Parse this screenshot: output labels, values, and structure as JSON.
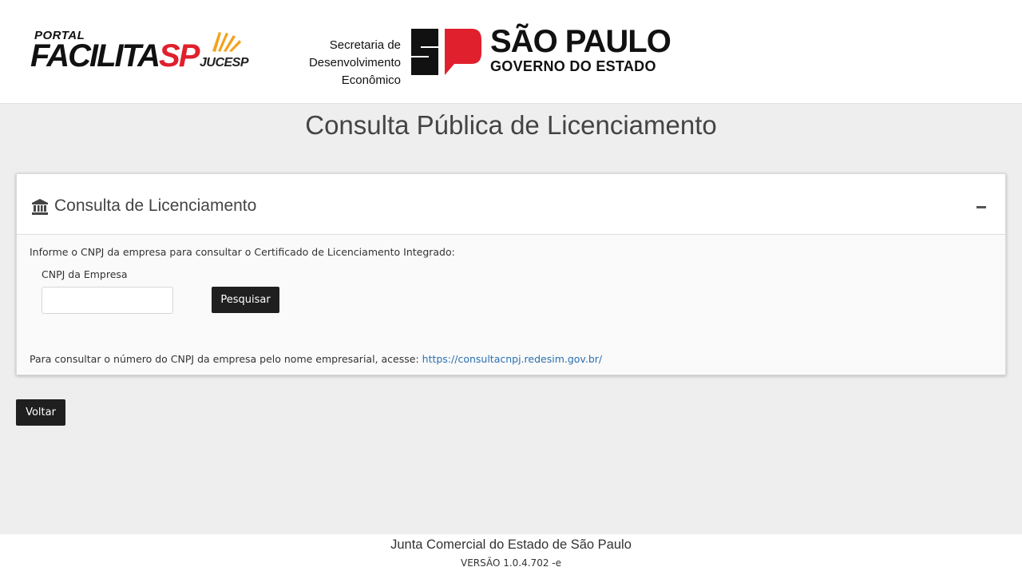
{
  "header": {
    "portal_logo": {
      "top": "PORTAL",
      "word": "FACILITA",
      "accent": "SP",
      "accent_color": "#e0202d"
    },
    "jucesp_logo": {
      "text": "JUCESP",
      "icon": "jucesp-rays-icon",
      "color": "#f4a21c"
    },
    "secretaria": {
      "line1": "Secretaria de",
      "line2": "Desenvolvimento Econômico"
    },
    "governo_logo": {
      "mark_icon": "sp-state-mark-icon",
      "title": "SÃO PAULO",
      "subtitle": "GOVERNO DO ESTADO",
      "accent_color": "#e0202d"
    }
  },
  "page": {
    "title": "Consulta Pública de Licenciamento"
  },
  "panel": {
    "icon": "bank-icon",
    "title": "Consulta de Licenciamento",
    "collapse_icon": "minus-icon",
    "instruction": "Informe o CNPJ da empresa para consultar o Certificado de Licenciamento Integrado:",
    "cnpj_label": "CNPJ da Empresa",
    "cnpj_value": "",
    "cnpj_placeholder": "",
    "search_button": "Pesquisar",
    "footnote_text": "Para consultar o número do CNPJ da empresa pelo nome empresarial, acesse: ",
    "footnote_link": "https://consultacnpj.redesim.gov.br/"
  },
  "back_button": "Voltar",
  "footer": {
    "org": "Junta Comercial do Estado de São Paulo",
    "version": "VERSÃO 1.0.4.702 -e"
  },
  "colors": {
    "background": "#eeeeee",
    "button": "#1f1f1f",
    "link": "#2a6fb0"
  }
}
